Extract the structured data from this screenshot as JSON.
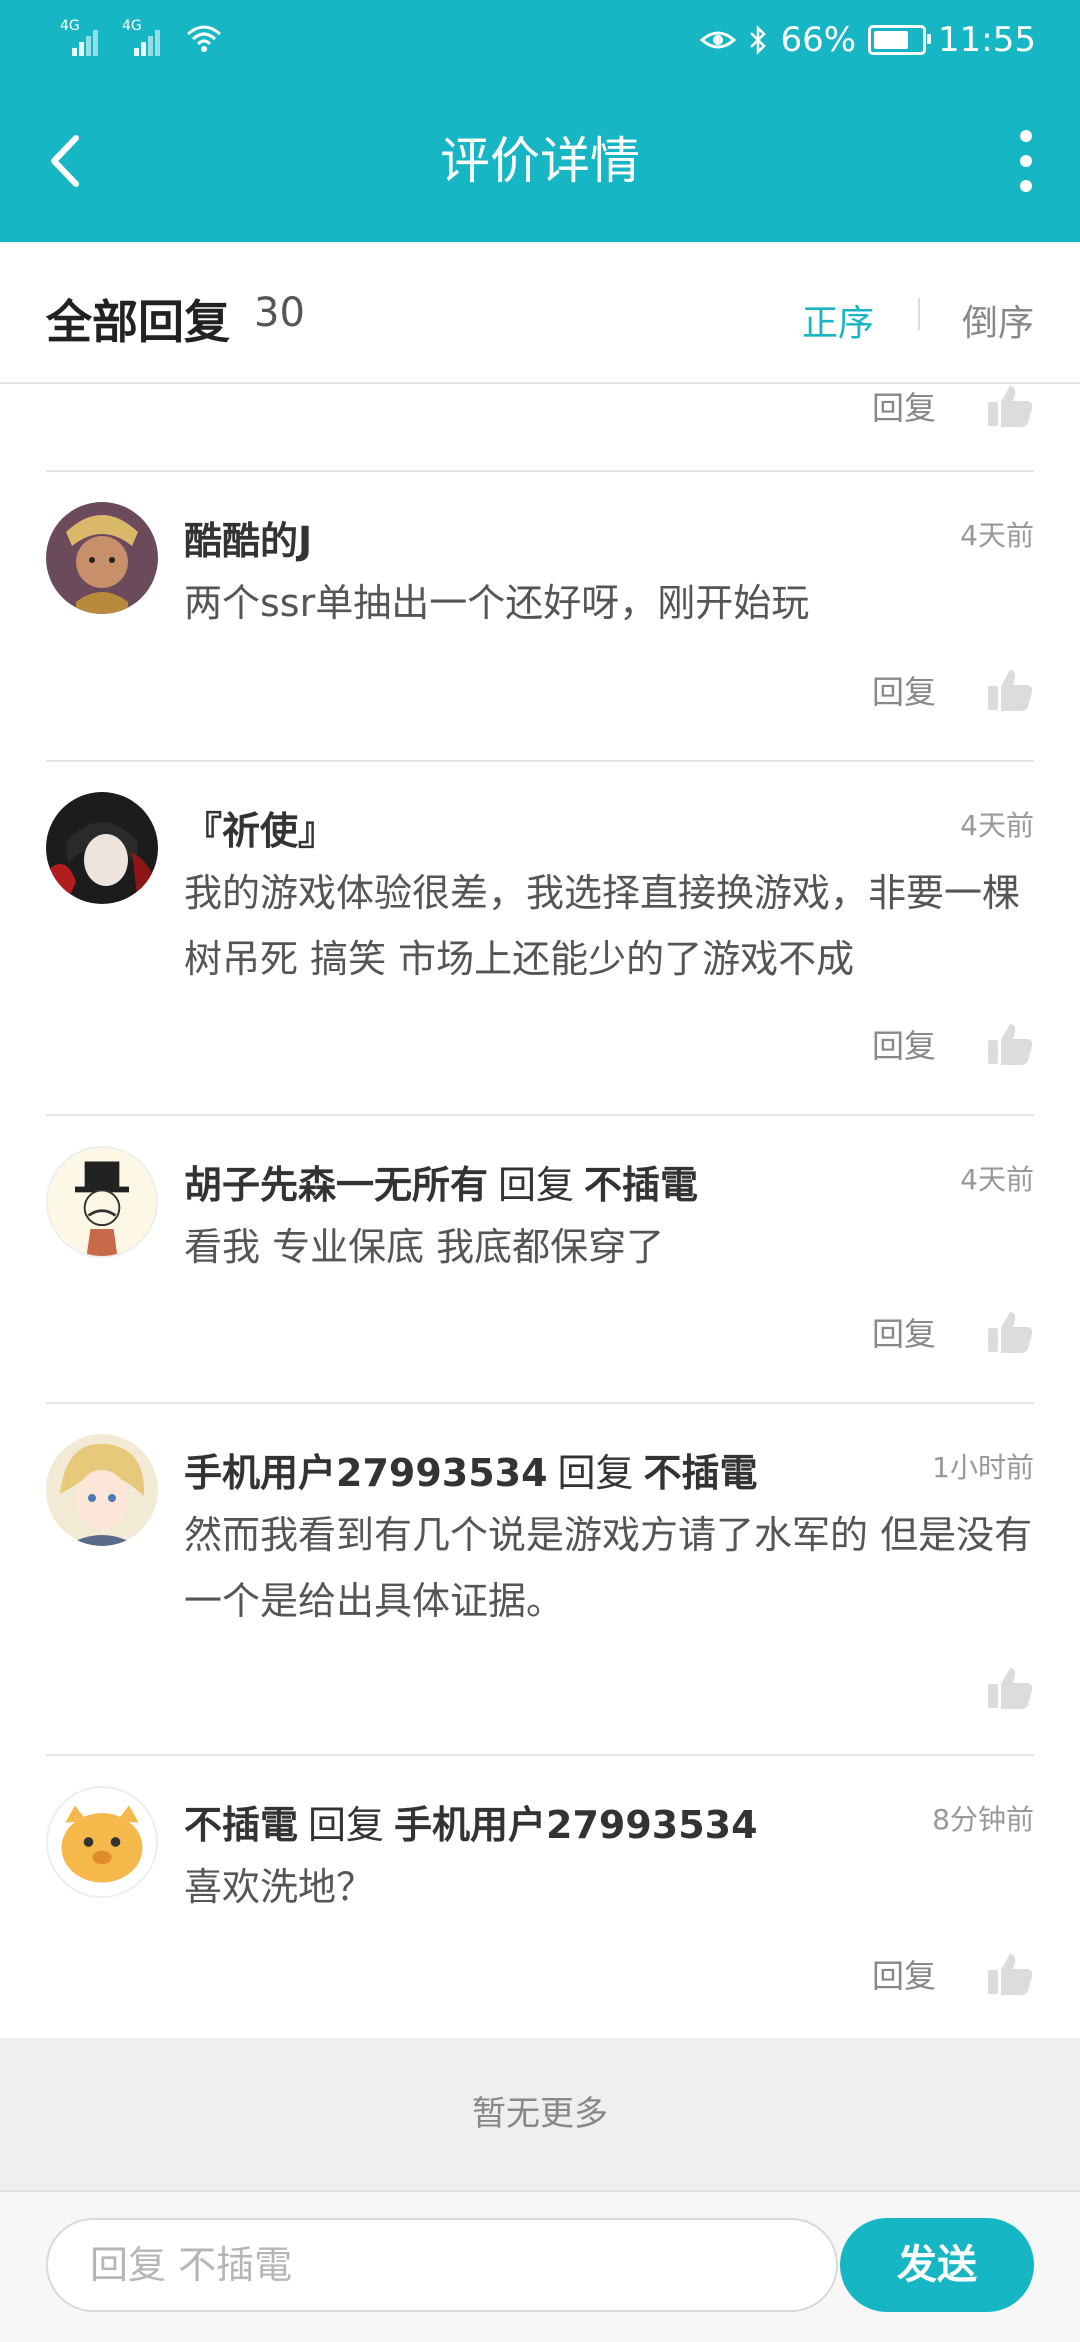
{
  "status_bar": {
    "signal_tags": [
      "4G",
      "4G"
    ],
    "battery_percent": "66%",
    "time": "11:55",
    "icons": [
      "signal-icon",
      "signal-icon",
      "wifi-icon",
      "eye-icon",
      "bluetooth-icon",
      "battery-icon"
    ]
  },
  "header": {
    "title": "评价详情"
  },
  "sort": {
    "title": "全部回复",
    "count": "30",
    "ascending": "正序",
    "descending": "倒序",
    "active": "正序",
    "accent": "#17b6c4"
  },
  "partial_row": {
    "reply_label": "回复"
  },
  "comments": [
    {
      "user": "酷酷的J",
      "reply_word": "",
      "target": "",
      "time": "4天前",
      "text": "两个ssr单抽出一个还好呀，刚开始玩",
      "reply_label": "回复"
    },
    {
      "user": "『祈使』",
      "reply_word": "",
      "target": "",
      "time": "4天前",
      "text": "我的游戏体验很差，我选择直接换游戏，非要一棵树吊死 搞笑 市场上还能少的了游戏不成",
      "reply_label": "回复"
    },
    {
      "user": "胡子先森一无所有",
      "reply_word": "回复",
      "target": "不插電",
      "time": "4天前",
      "text": "看我  专业保底  我底都保穿了",
      "reply_label": "回复"
    },
    {
      "user": "手机用户27993534",
      "reply_word": "回复",
      "target": "不插電",
      "time": "1小时前",
      "text": "然而我看到有几个说是游戏方请了水军的 但是没有一个是给出具体证据。",
      "reply_label": ""
    },
    {
      "user": "不插電",
      "reply_word": "回复",
      "target": "手机用户27993534",
      "time": "8分钟前",
      "text": "喜欢洗地？",
      "reply_label": "回复"
    }
  ],
  "footer": {
    "no_more": "暂无更多",
    "input_placeholder": "回复 不插電",
    "send_label": "发送"
  }
}
